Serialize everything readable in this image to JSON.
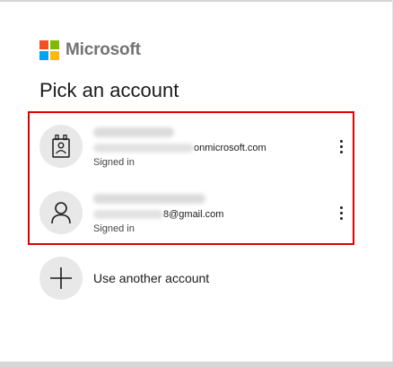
{
  "brand": {
    "name": "Microsoft",
    "logo_colors": {
      "red": "#f25022",
      "green": "#7fba00",
      "blue": "#00a4ef",
      "yellow": "#ffb900"
    }
  },
  "page": {
    "title": "Pick an account",
    "highlight_color": "#e00000"
  },
  "accounts": [
    {
      "avatar_icon": "id-badge-icon",
      "name_hidden": true,
      "email_visible_suffix": "onmicrosoft.com",
      "status": "Signed in"
    },
    {
      "avatar_icon": "person-icon",
      "name_hidden": true,
      "email_visible_suffix": "8@gmail.com",
      "status": "Signed in"
    }
  ],
  "add_account": {
    "icon": "plus-icon",
    "label": "Use another account"
  }
}
